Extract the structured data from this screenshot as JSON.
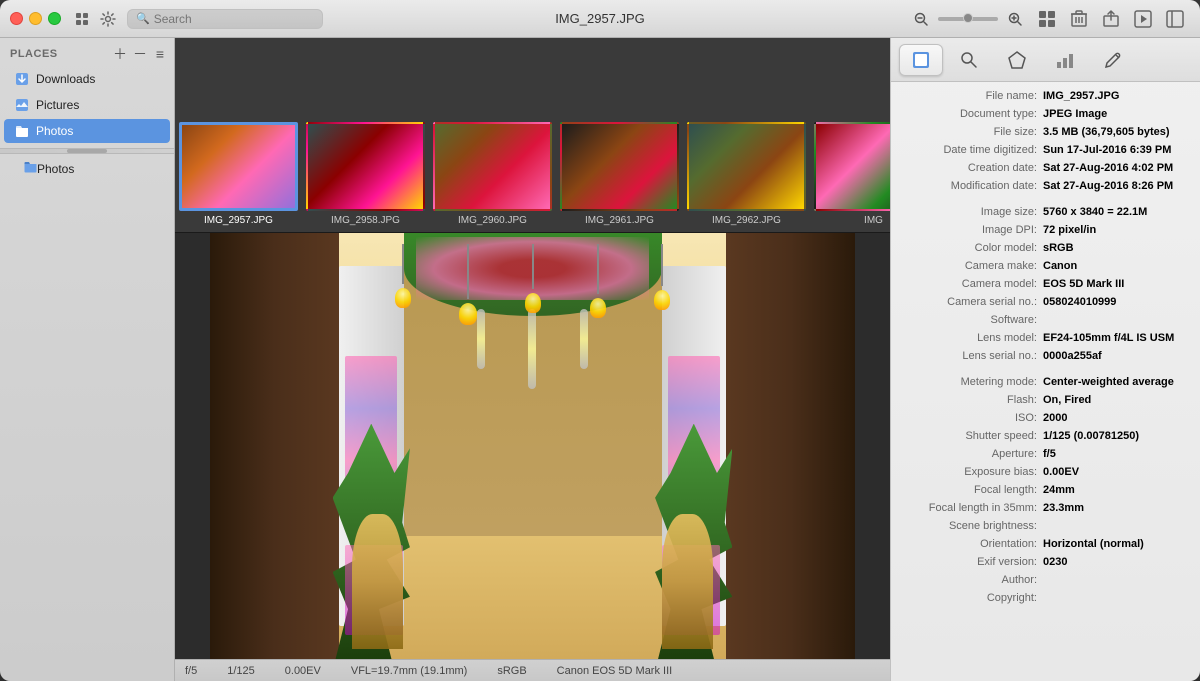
{
  "window": {
    "title": "IMG_2957.JPG"
  },
  "titlebar": {
    "search_placeholder": "Search",
    "traffic_lights": [
      "close",
      "minimize",
      "maximize"
    ]
  },
  "sidebar": {
    "header": "Places",
    "items": [
      {
        "id": "downloads",
        "label": "Downloads",
        "icon": "📥"
      },
      {
        "id": "pictures",
        "label": "Pictures",
        "icon": "🖼"
      },
      {
        "id": "photos",
        "label": "Photos",
        "icon": "📁",
        "active": true
      },
      {
        "id": "photos-sub",
        "label": "Photos",
        "icon": "📁",
        "sub": true
      }
    ]
  },
  "thumbnails": [
    {
      "id": "t1",
      "label": "IMG_2957.JPG",
      "selected": true,
      "color_class": "thumb-color-1"
    },
    {
      "id": "t2",
      "label": "IMG_2958.JPG",
      "selected": false,
      "color_class": "thumb-color-2"
    },
    {
      "id": "t3",
      "label": "IMG_2960.JPG",
      "selected": false,
      "color_class": "thumb-color-3"
    },
    {
      "id": "t4",
      "label": "IMG_2961.JPG",
      "selected": false,
      "color_class": "thumb-color-4"
    },
    {
      "id": "t5",
      "label": "IMG_2962.JPG",
      "selected": false,
      "color_class": "thumb-color-5"
    },
    {
      "id": "t6",
      "label": "IMG",
      "selected": false,
      "color_class": "thumb-color-6"
    }
  ],
  "statusbar": {
    "items": [
      {
        "id": "aperture",
        "value": "f/5"
      },
      {
        "id": "shutter",
        "value": "1/125"
      },
      {
        "id": "ev",
        "value": "0.00EV"
      },
      {
        "id": "focal",
        "value": "VFL=19.7mm (19.1mm)"
      },
      {
        "id": "colorspace",
        "value": "sRGB"
      },
      {
        "id": "camera",
        "value": "Canon EOS 5D Mark III"
      }
    ]
  },
  "inspector": {
    "tabs": [
      {
        "id": "preview",
        "icon": "◻",
        "active": true
      },
      {
        "id": "search",
        "icon": "🔍",
        "active": false
      },
      {
        "id": "filter",
        "icon": "⬡",
        "active": false
      },
      {
        "id": "chart",
        "icon": "📊",
        "active": false
      },
      {
        "id": "edit",
        "icon": "✏",
        "active": false
      }
    ],
    "fields": [
      {
        "label": "File name:",
        "value": "IMG_2957.JPG",
        "bold": true
      },
      {
        "label": "Document type:",
        "value": "JPEG Image",
        "bold": true
      },
      {
        "label": "File size:",
        "value": "3.5 MB (36,79,605 bytes)",
        "bold": true
      },
      {
        "label": "Date time digitized:",
        "value": "Sun 17-Jul-2016  6:39 PM",
        "bold": true
      },
      {
        "label": "Creation date:",
        "value": "Sat 27-Aug-2016  4:02 PM",
        "bold": true
      },
      {
        "label": "Modification date:",
        "value": "Sat 27-Aug-2016  8:26 PM",
        "bold": true
      },
      {
        "label": "_gap",
        "value": ""
      },
      {
        "label": "Image size:",
        "value": "5760 x 3840 = 22.1M",
        "bold": true
      },
      {
        "label": "Image DPI:",
        "value": "72 pixel/in",
        "bold": true
      },
      {
        "label": "Color model:",
        "value": "sRGB",
        "bold": true
      },
      {
        "label": "Camera make:",
        "value": "Canon",
        "bold": true
      },
      {
        "label": "Camera model:",
        "value": "EOS 5D Mark III",
        "bold": true
      },
      {
        "label": "Camera serial no.:",
        "value": "058024010999",
        "bold": true
      },
      {
        "label": "Software:",
        "value": "",
        "bold": false
      },
      {
        "label": "Lens model:",
        "value": "EF24-105mm f/4L IS USM",
        "bold": true
      },
      {
        "label": "Lens serial no.:",
        "value": "0000a255af",
        "bold": true
      },
      {
        "label": "_gap",
        "value": ""
      },
      {
        "label": "Metering mode:",
        "value": "Center-weighted average",
        "bold": true
      },
      {
        "label": "Flash:",
        "value": "On, Fired",
        "bold": true
      },
      {
        "label": "ISO:",
        "value": "2000",
        "bold": true
      },
      {
        "label": "Shutter speed:",
        "value": "1/125 (0.00781250)",
        "bold": true
      },
      {
        "label": "Aperture:",
        "value": "f/5",
        "bold": true
      },
      {
        "label": "Exposure bias:",
        "value": "0.00EV",
        "bold": true
      },
      {
        "label": "Focal length:",
        "value": "24mm",
        "bold": true
      },
      {
        "label": "Focal length in 35mm:",
        "value": "23.3mm",
        "bold": true
      },
      {
        "label": "Scene brightness:",
        "value": "",
        "bold": false
      },
      {
        "label": "Orientation:",
        "value": "Horizontal (normal)",
        "bold": true
      },
      {
        "label": "Exif version:",
        "value": "0230",
        "bold": true
      },
      {
        "label": "Author:",
        "value": "",
        "bold": false
      },
      {
        "label": "Copyright:",
        "value": "",
        "bold": false
      }
    ]
  }
}
